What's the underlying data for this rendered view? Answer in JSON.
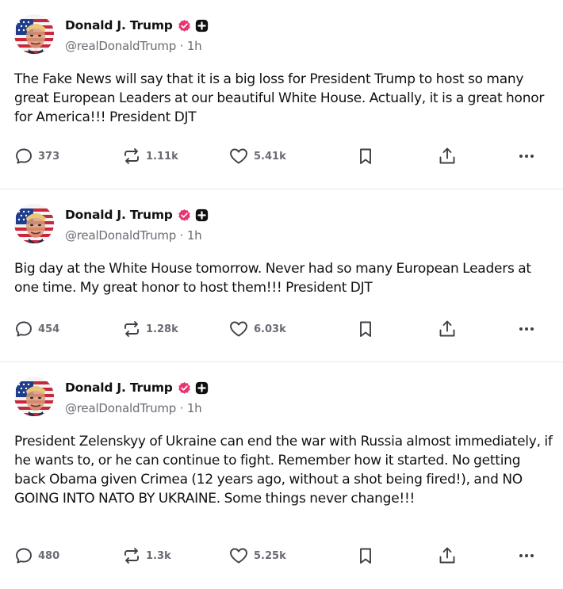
{
  "colors": {
    "verified_badge": "#e8356f",
    "plus_badge": "#111111",
    "text": "#111111",
    "muted": "#6b6b74"
  },
  "icons": {
    "reply": "speech-bubble-icon",
    "retruth": "repost-arrows-icon",
    "like": "heart-icon",
    "bookmark": "bookmark-icon",
    "share": "share-icon",
    "more": "ellipsis-icon"
  },
  "posts": [
    {
      "display_name": "Donald J. Trump",
      "handle": "@realDonaldTrump",
      "time": "1h",
      "text": "The Fake News will say that it is a big loss for President Trump to host so many great European Leaders at our beautiful White House. Actually, it is a great honor for America!!! President DJT",
      "replies": "373",
      "retruths": "1.11k",
      "likes": "5.41k"
    },
    {
      "display_name": "Donald J. Trump",
      "handle": "@realDonaldTrump",
      "time": "1h",
      "text": "Big day at the White House tomorrow. Never had so many European Leaders at one time. My great honor to host them!!! President DJT",
      "replies": "454",
      "retruths": "1.28k",
      "likes": "6.03k"
    },
    {
      "display_name": "Donald J. Trump",
      "handle": "@realDonaldTrump",
      "time": "1h",
      "text": "President Zelenskyy of Ukraine can end the war with Russia almost immediately, if he wants to, or he can continue to fight. Remember how it started. No getting back Obama given Crimea (12 years ago, without a shot being fired!), and NO GOING INTO NATO BY UKRAINE. Some things never change!!!",
      "replies": "480",
      "retruths": "1.3k",
      "likes": "5.25k"
    }
  ]
}
